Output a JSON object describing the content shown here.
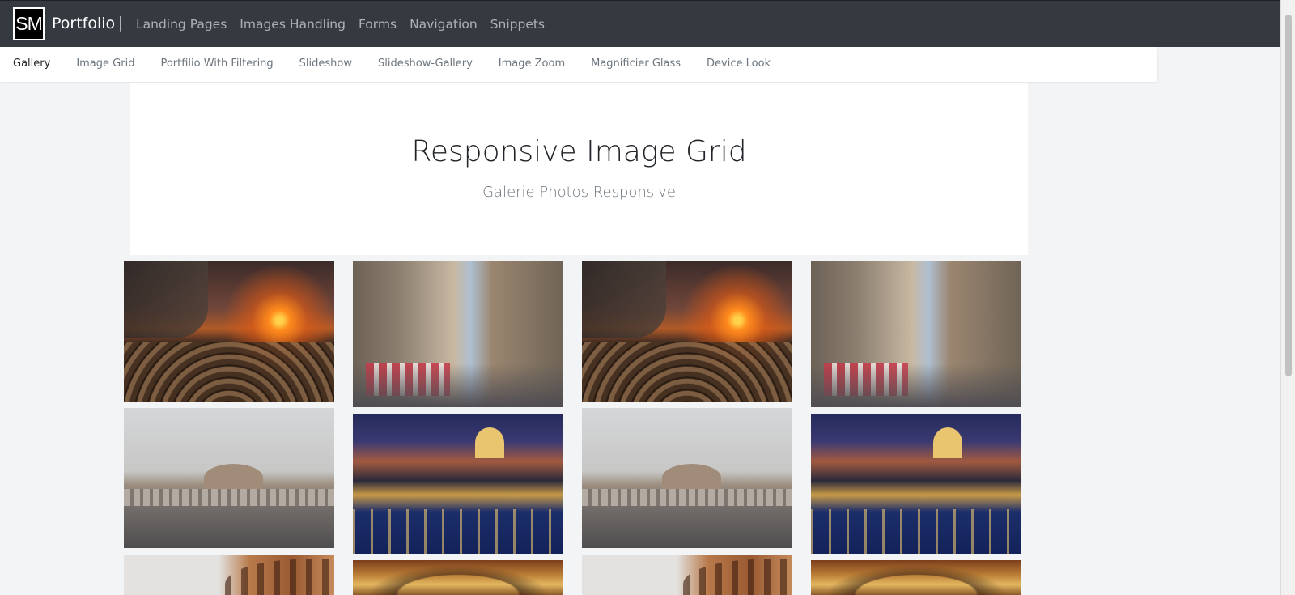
{
  "navbar": {
    "logo_text": "SM",
    "brand": "Portfolio",
    "separator": "|",
    "links": [
      "Landing Pages",
      "Images Handling",
      "Forms",
      "Navigation",
      "Snippets"
    ]
  },
  "subnav": {
    "items": [
      "Gallery",
      "Image Grid",
      "Portfilio With Filtering",
      "Slideshow",
      "Slideshow-Gallery",
      "Image Zoom",
      "Magnificier Glass",
      "Device Look"
    ],
    "active": "Gallery"
  },
  "hero": {
    "title": "Responsive Image Grid",
    "subtitle": "Galerie Photos Responsive"
  },
  "gallery": {
    "photos": [
      {
        "subject": "sunset arch cobblestones"
      },
      {
        "subject": "rome street cafe"
      },
      {
        "subject": "sunset arch cobblestones"
      },
      {
        "subject": "rome street cafe"
      },
      {
        "subject": "castel sant angelo bridge"
      },
      {
        "subject": "st peters night river"
      },
      {
        "subject": "castel sant angelo bridge"
      },
      {
        "subject": "st peters night river"
      },
      {
        "subject": "colosseum"
      },
      {
        "subject": "arch closeup"
      },
      {
        "subject": "colosseum"
      },
      {
        "subject": "arch closeup"
      }
    ]
  }
}
